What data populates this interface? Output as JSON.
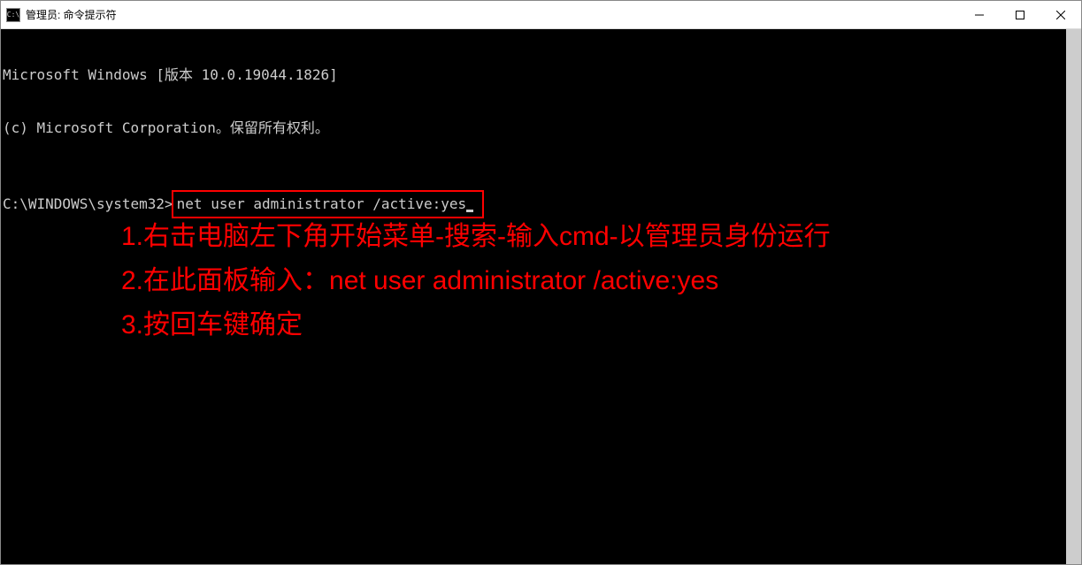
{
  "window": {
    "title": "管理员: 命令提示符",
    "icon_text": "C:\\"
  },
  "console": {
    "header_line1": "Microsoft Windows [版本 10.0.19044.1826]",
    "header_line2": "(c) Microsoft Corporation。保留所有权利。",
    "prompt_prefix": "C:\\WINDOWS\\system32>",
    "command": "net user administrator /active:yes"
  },
  "annotation": {
    "line1": "1.右击电脑左下角开始菜单-搜索-输入cmd-以管理员身份运行",
    "line2": "2.在此面板输入：net user administrator /active:yes",
    "line3": "3.按回车键确定"
  },
  "colors": {
    "annotation": "#ff0000",
    "console_bg": "#000000",
    "console_fg": "#cccccc"
  }
}
